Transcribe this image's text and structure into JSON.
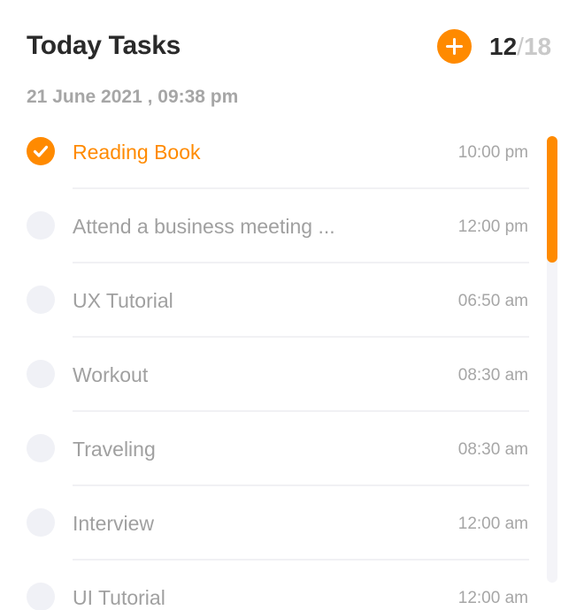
{
  "header": {
    "title": "Today Tasks",
    "add_icon": "plus-icon",
    "counter": {
      "done": "12",
      "separator": "/",
      "total": "18"
    },
    "datetime": "21 June 2021 , 09:38 pm"
  },
  "tasks": [
    {
      "label": "Reading Book",
      "time": "10:00 pm",
      "done": true
    },
    {
      "label": "Attend a business meeting ...",
      "time": "12:00 pm",
      "done": false
    },
    {
      "label": "UX Tutorial",
      "time": "06:50 am",
      "done": false
    },
    {
      "label": "Workout",
      "time": "08:30 am",
      "done": false
    },
    {
      "label": "Traveling",
      "time": "08:30 am",
      "done": false
    },
    {
      "label": "Interview",
      "time": "12:00 am",
      "done": false
    },
    {
      "label": "UI Tutorial",
      "time": "12:00 am",
      "done": false
    }
  ],
  "colors": {
    "accent": "#ff8a00",
    "text_primary": "#2a2a2a",
    "text_muted": "#a0a0a0",
    "check_empty": "#f0f1f6",
    "divider": "#f1f1f4"
  },
  "icons": {
    "checked": "check-icon",
    "unchecked": "empty-circle-icon"
  }
}
